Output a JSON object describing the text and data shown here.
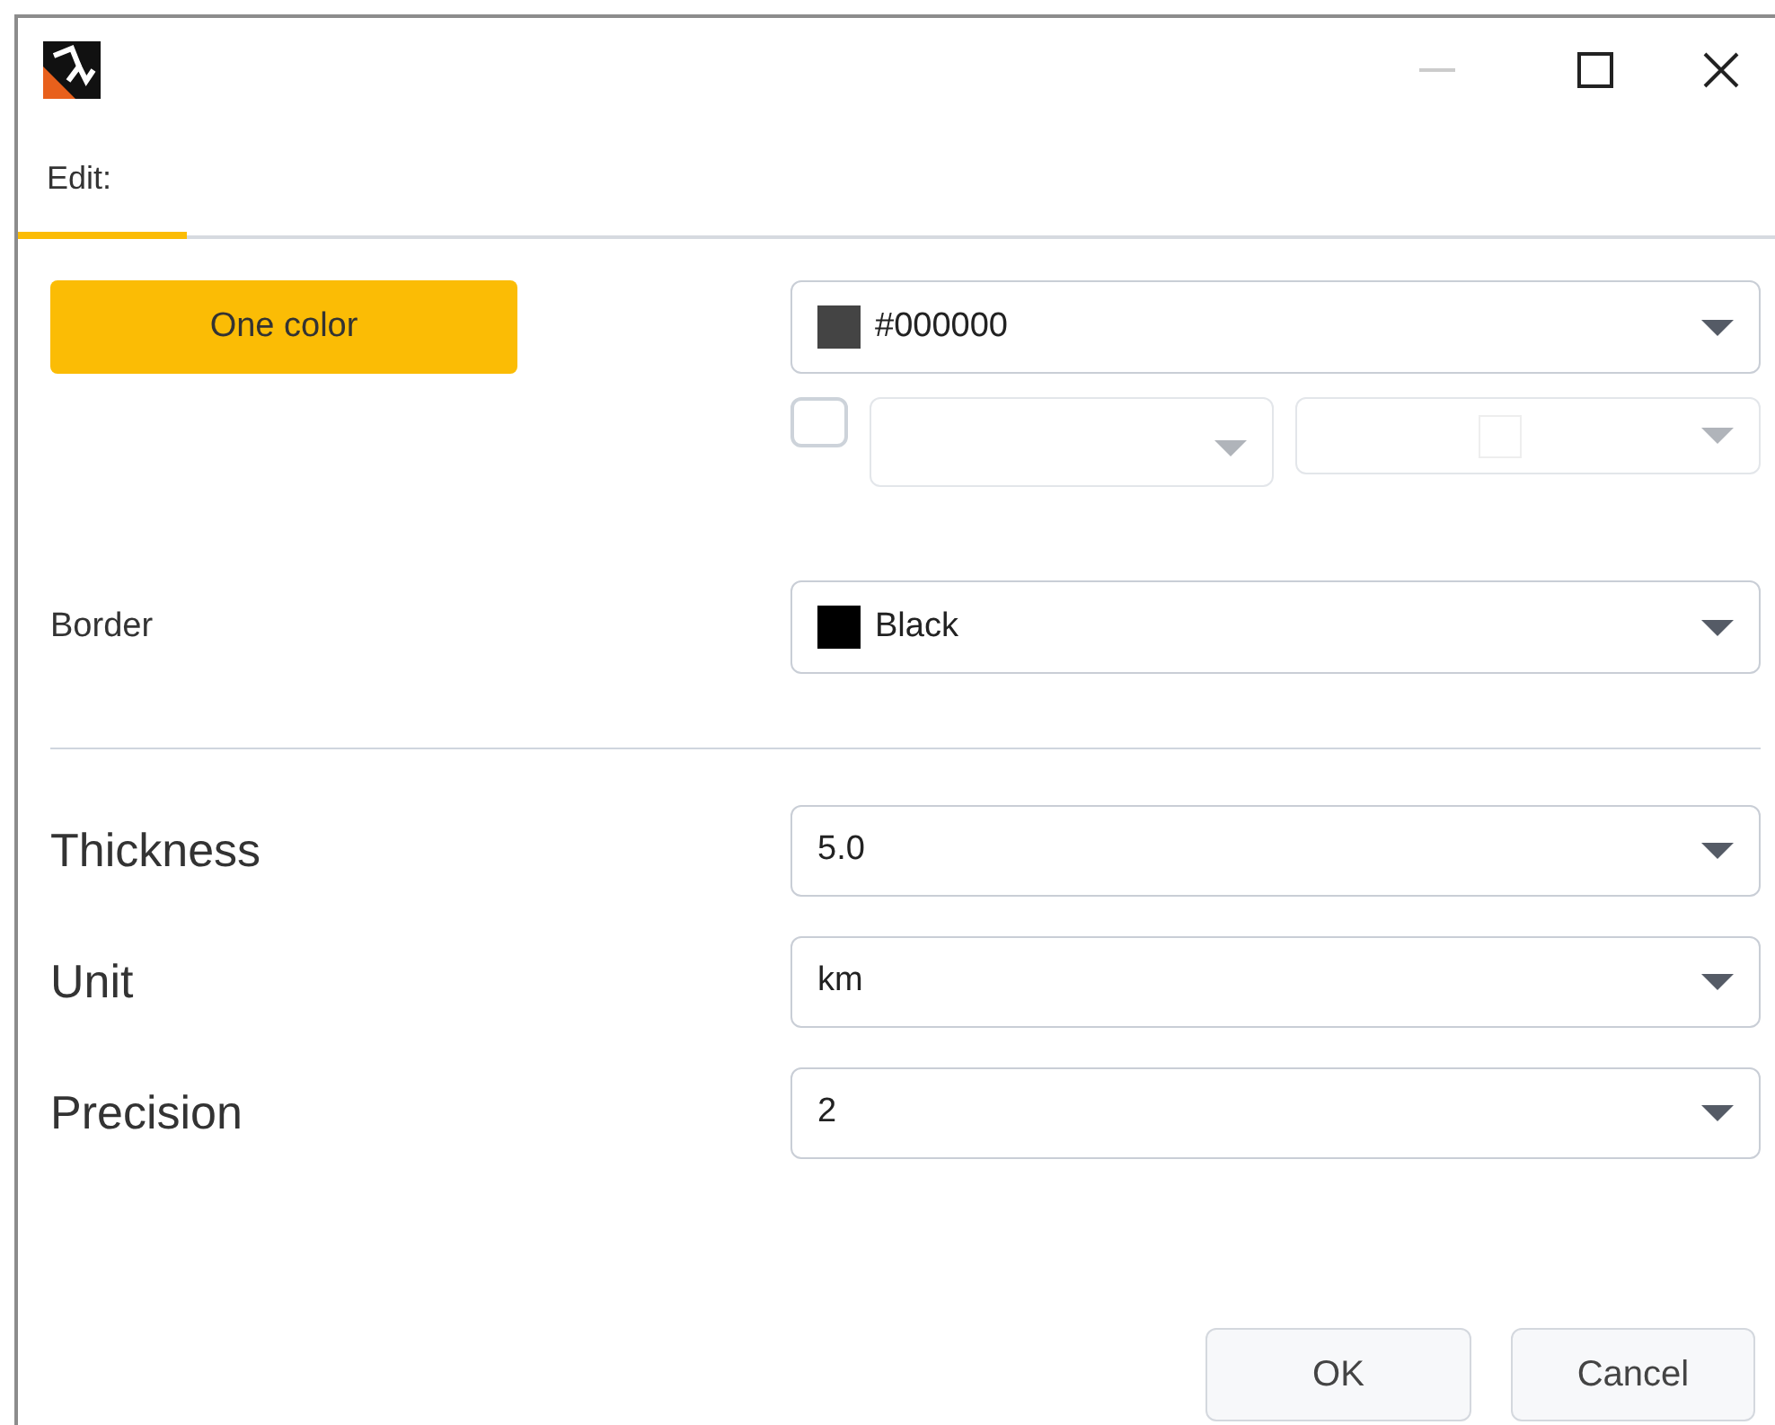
{
  "window": {
    "controls": [
      {
        "kind": "minimize"
      },
      {
        "kind": "maximize"
      },
      {
        "kind": "close"
      }
    ]
  },
  "tabs": [
    {
      "label": "Edit:",
      "selected": true
    }
  ],
  "fill": {
    "mode_button": "One color",
    "color": {
      "value": "#000000",
      "color": "#444444"
    },
    "gradient": {
      "checked": false,
      "disabled": true
    }
  },
  "border": {
    "label": "Border",
    "value": "Black",
    "color": "#000000"
  },
  "fields": [
    {
      "label": "Thickness",
      "value": "5.0"
    },
    {
      "label": "Unit",
      "value": "km"
    },
    {
      "label": "Precision",
      "value": "2"
    }
  ],
  "buttons": [
    "OK",
    "Cancel"
  ]
}
